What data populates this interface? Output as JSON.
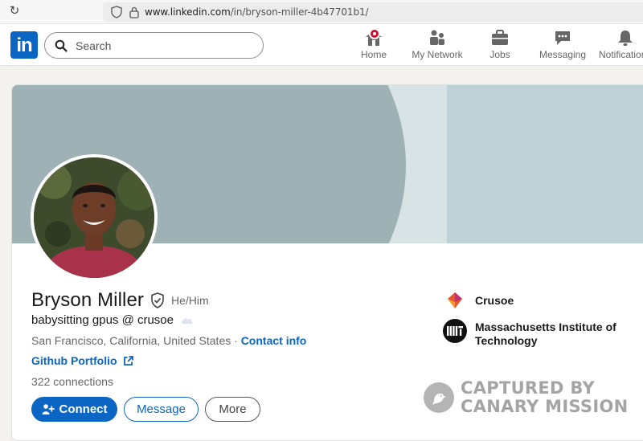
{
  "browser": {
    "url_host": "www.linkedin.com",
    "url_path": "/in/bryson-miller-4b47701b1/"
  },
  "nav": {
    "logo_text": "in",
    "search_placeholder": "Search",
    "items": [
      {
        "label": "Home",
        "icon": "home-icon"
      },
      {
        "label": "My Network",
        "icon": "network-icon"
      },
      {
        "label": "Jobs",
        "icon": "briefcase-icon"
      },
      {
        "label": "Messaging",
        "icon": "messaging-icon"
      },
      {
        "label": "Notifications",
        "icon": "bell-icon"
      }
    ]
  },
  "profile": {
    "name": "Bryson Miller",
    "pronouns": "He/Him",
    "headline": "babysitting gpus @ crusoe",
    "location": "San Francisco, California, United States",
    "separator": " · ",
    "contact_info": "Contact info",
    "portfolio": "Github Portfolio",
    "connections": "322 connections",
    "buttons": {
      "connect": "Connect",
      "message": "Message",
      "more": "More"
    },
    "organizations": [
      {
        "name": "Crusoe"
      },
      {
        "name": "Massachusetts Institute of Technology"
      }
    ]
  },
  "watermark": {
    "line1": "CAPTURED BY",
    "line2": "CANARY MISSION"
  },
  "colors": {
    "brand": "#0a66c2",
    "badge": "#cb112d",
    "banner_dark": "#9eb2b5",
    "banner_light": "#bed1d6"
  }
}
